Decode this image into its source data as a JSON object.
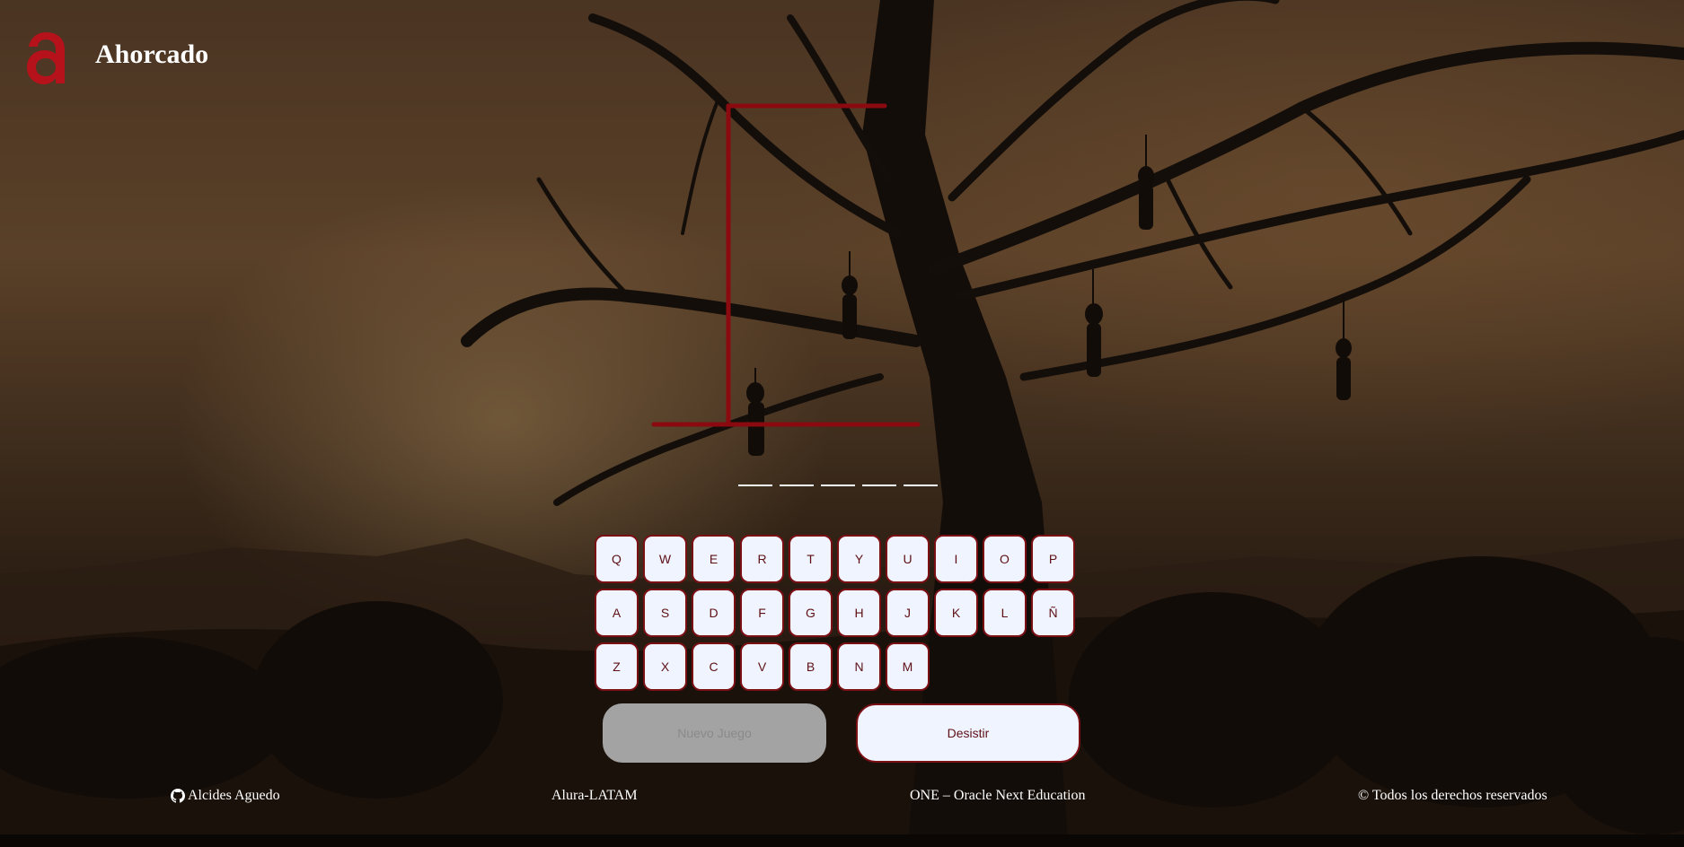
{
  "header": {
    "title": "Ahorcado",
    "logo_icon": "alura-logo-icon"
  },
  "game": {
    "word_slots": 5,
    "keyboard": {
      "rows": [
        [
          "Q",
          "W",
          "E",
          "R",
          "T",
          "Y",
          "U",
          "I",
          "O",
          "P"
        ],
        [
          "A",
          "S",
          "D",
          "F",
          "G",
          "H",
          "J",
          "K",
          "L",
          "Ñ"
        ],
        [
          "Z",
          "X",
          "C",
          "V",
          "B",
          "N",
          "M"
        ]
      ]
    },
    "buttons": {
      "new_game": "Nuevo Juego",
      "give_up": "Desistir"
    }
  },
  "footer": {
    "author": "Alcides Aguedo",
    "author_icon": "github-icon",
    "org": "Alura-LATAM",
    "program": "ONE – Oracle Next Education",
    "rights": "© Todos los derechos reservados"
  },
  "colors": {
    "accent": "#8b0a10",
    "key_bg": "#eff4ff",
    "key_text": "#5e1015",
    "disabled_bg": "#a3a3a3"
  }
}
